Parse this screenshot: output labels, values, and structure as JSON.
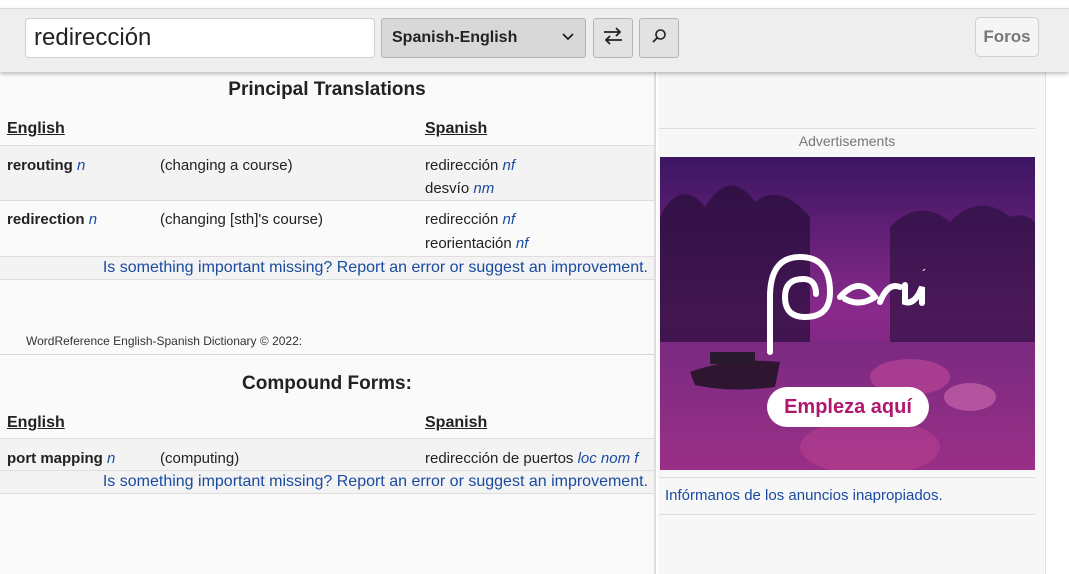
{
  "header": {
    "search_value": "redirección",
    "dictionary_selected": "Spanish-English",
    "swap_icon": "swap-arrows-icon",
    "search_icon": "search-icon",
    "forum_label": "Foros"
  },
  "principal": {
    "title": "Principal Translations",
    "col_source": "English",
    "col_target": "Spanish",
    "rows": [
      {
        "term": "rerouting",
        "pos": "n",
        "sense": "(changing a course)",
        "translations": [
          {
            "word": "redirección",
            "pos": "nf"
          },
          {
            "word": "desvío",
            "pos": "nm"
          }
        ]
      },
      {
        "term": "redirection",
        "pos": "n",
        "sense": "(changing [sth]'s course)",
        "translations": [
          {
            "word": "redirección",
            "pos": "nf"
          },
          {
            "word": "reorientación",
            "pos": "nf"
          }
        ]
      }
    ],
    "report_link": "Is something important missing? Report an error or suggest an improvement."
  },
  "copyright": "WordReference English-Spanish Dictionary © 2022:",
  "compound": {
    "title": "Compound Forms:",
    "col_source": "English",
    "col_target": "Spanish",
    "rows": [
      {
        "term": "port mapping",
        "pos": "n",
        "sense": "(computing)",
        "translations": [
          {
            "word": "redirección de puertos",
            "pos": "loc nom f"
          }
        ]
      }
    ],
    "report_link": "Is something important missing? Report an error or suggest an improvement."
  },
  "sidebar": {
    "ads_label": "Advertisements",
    "ad_brand": "Perú",
    "ad_cta": "Empleza aquí",
    "report_ads_link": "Infórmanos de los anuncios inapropiados."
  },
  "colors": {
    "link": "#1a4ba0",
    "header_bg": "#eeeeee",
    "ad_magenta": "#b0186f"
  }
}
